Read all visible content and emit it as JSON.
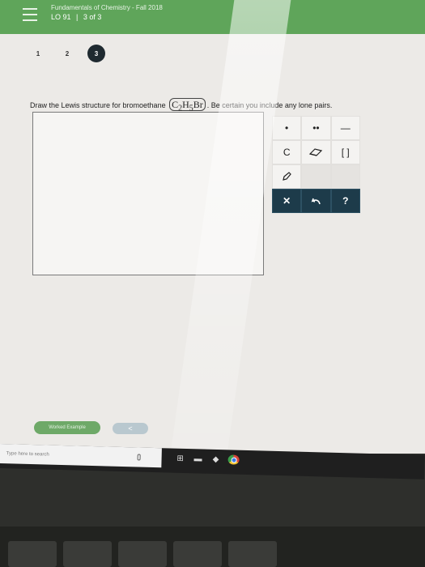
{
  "header": {
    "course": "Fundamentals of Chemistry - Fall 2018",
    "lo": "LO 91",
    "progress": "3 of 3",
    "sep": "|"
  },
  "steps": [
    "1",
    "2",
    "3"
  ],
  "question": {
    "prefix": "Draw the Lewis structure for bromoethane",
    "formula": "C2H5Br",
    "suffix": ". Be certain you include any lone pairs."
  },
  "palette": {
    "row1": [
      "•",
      "••",
      "—"
    ],
    "row2": [
      "C",
      "eraser-icon",
      "[ ]"
    ],
    "row3": [
      "pencil-icon",
      "",
      ""
    ],
    "row4": [
      "✕",
      "undo-icon",
      "?"
    ]
  },
  "footer": {
    "worked_example": "Worked Example",
    "prev": "<"
  },
  "taskbar": {
    "search": "Type here to search"
  }
}
